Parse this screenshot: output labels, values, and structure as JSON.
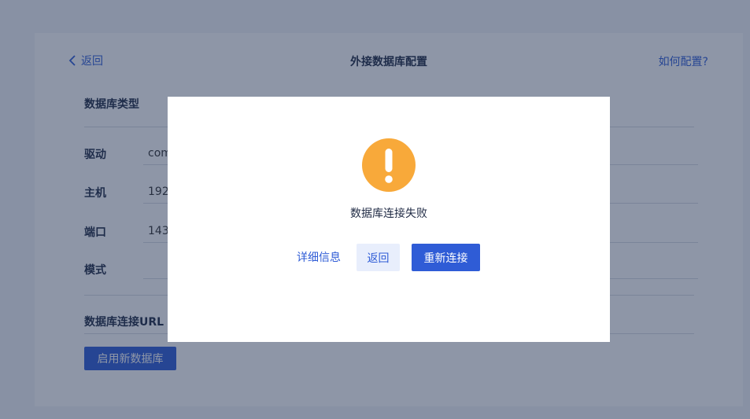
{
  "header": {
    "back_label": "返回",
    "title": "外接数据库配置",
    "help_label": "如何配置?"
  },
  "form": {
    "db_type_label": "数据库类型",
    "driver_label": "驱动",
    "driver_value": "com",
    "host_label": "主机",
    "host_value": "192",
    "port_label": "端口",
    "port_value": "143",
    "schema_label": "模式",
    "schema_value": "",
    "url_label": "数据库连接URL",
    "enable_button": "启用新数据库"
  },
  "modal": {
    "icon": "warning-icon",
    "message": "数据库连接失败",
    "detail_label": "详细信息",
    "back_label": "返回",
    "reconnect_label": "重新连接"
  },
  "colors": {
    "primary": "#2f5cd6",
    "warning": "#f8a93a",
    "overlay": "rgba(30,45,80,0.5)"
  }
}
